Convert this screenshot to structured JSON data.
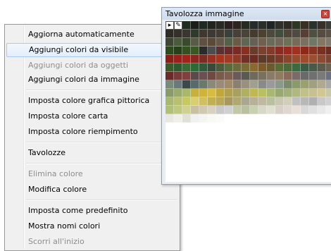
{
  "context_menu": {
    "items": [
      {
        "label": "Aggiorna automaticamente",
        "disabled": false
      },
      {
        "label": "Aggiungi colori da visibile",
        "disabled": false,
        "highlighted": true
      },
      {
        "label": "Aggiungi colori da oggetti",
        "disabled": true
      },
      {
        "label": "Aggiungi colori da immagine",
        "disabled": false
      },
      {
        "label": "Imposta colore grafica pittorica",
        "disabled": false
      },
      {
        "label": "Imposta colore carta",
        "disabled": false
      },
      {
        "label": "Imposta colore riempimento",
        "disabled": false
      },
      {
        "label": "Tavolozze",
        "disabled": false
      },
      {
        "label": "Elimina colore",
        "disabled": true
      },
      {
        "label": "Modifica colore",
        "disabled": false
      },
      {
        "label": "Imposta come predefinito",
        "disabled": false
      },
      {
        "label": "Mostra nomi colori",
        "disabled": false
      },
      {
        "label": "Scorri all'inizio",
        "disabled": true
      }
    ]
  },
  "palette_window": {
    "title": "Tavolozza immagine",
    "close_glyph": "×",
    "tool_icons": [
      "dropdown-arrow-icon",
      "eyedropper-icon"
    ],
    "tool_glyphs": [
      "▸",
      "✎"
    ],
    "swatch_rows": [
      [
        "#1f1f1f",
        "#1f1f1f",
        "#1f2b1f",
        "#1b1f1b",
        "#1e2a22",
        "#24241f",
        "#2a2a24",
        "#2b1f1f",
        "#2b241f",
        "#262a20",
        "#242b2a",
        "#2a2f2a",
        "#1f2424",
        "#30302a",
        "#302a24",
        "#2f3724",
        "#383024",
        "#2a3230",
        "#37302b",
        "#3a3d38"
      ],
      [
        "#2e2a26",
        "#35302a",
        "#3a3530",
        "#2f3a2c",
        "#40382e",
        "#3d3a35",
        "#443c32",
        "#3a403a",
        "#473f38",
        "#4a4438",
        "#453c2f",
        "#4b4232",
        "#4c4a3d",
        "#424d3c",
        "#504539",
        "#4f4a42",
        "#563f35",
        "#4e5040",
        "#574c42",
        "#5a5246"
      ],
      [
        "#3e4532",
        "#4a5a3a",
        "#3a4a2c",
        "#5a5a48",
        "#605040",
        "#5c4a38",
        "#63584a",
        "#556048",
        "#6a5a46",
        "#5e6654",
        "#665f55",
        "#706050",
        "#6a6a5a",
        "#73675a",
        "#6e7058",
        "#786a5a",
        "#7a7060",
        "#6f7866",
        "#847660",
        "#807a6c"
      ],
      [
        "#2d4a1e",
        "#284018",
        "#335220",
        "#3a5826",
        "#2a2a2a",
        "#4d4d4d",
        "#5a3030",
        "#6a2a2a",
        "#7a2a22",
        "#883020",
        "#6a3a2a",
        "#7a4030",
        "#843a2a",
        "#8a2a20",
        "#9a2a20",
        "#a03020",
        "#902818",
        "#883422",
        "#7a3020",
        "#6a2c20"
      ],
      [
        "#8a1f1a",
        "#9a2019",
        "#a2231c",
        "#8c2420",
        "#7d2a22",
        "#9a2f20",
        "#a8341e",
        "#a03a24",
        "#8e3a26",
        "#703028",
        "#6a2c22",
        "#5a3a2a",
        "#6a3a28",
        "#7a3a2a",
        "#8a442a",
        "#964a2e",
        "#a04a2c",
        "#9a5030",
        "#8a4a34",
        "#7a4430"
      ],
      [
        "#3a5a2a",
        "#2f5a2e",
        "#3a6a34",
        "#2c6a36",
        "#305a3a",
        "#3a4a3a",
        "#4a5a3a",
        "#5a6a3a",
        "#6a6a3a",
        "#7a6a34",
        "#8a6a30",
        "#7a5a2a",
        "#6a5a30",
        "#5a6a34",
        "#4a6a3a",
        "#3a6a40",
        "#3a5a44",
        "#4a5a4a",
        "#5a5a4a",
        "#6a6050"
      ],
      [
        "#6a2a2a",
        "#7a3a3a",
        "#804040",
        "#5a4a4a",
        "#6a5050",
        "#704a40",
        "#7a5a4a",
        "#806050",
        "#6a5a5a",
        "#5a5a50",
        "#706a5a",
        "#7a7060",
        "#8a7a68",
        "#907a60",
        "#8a6a5a",
        "#7a6a6a",
        "#6a6a6a",
        "#707070",
        "#7a7a7a",
        "#6a7080"
      ],
      [
        "#7a8a7a",
        "#6a7a7a",
        "#3a4a4a",
        "#5a6a6a",
        "#6a7a6a",
        "#8a8a7a",
        "#9a8a7a",
        "#a08a6a",
        "#8a8070",
        "#9a9080",
        "#a0a090",
        "#8a8a8a",
        "#9a9a9a",
        "#8a9a8a",
        "#7a8a6a",
        "#8a9a6a",
        "#9aa070",
        "#a0a080",
        "#b0a890",
        "#a8a8a8"
      ],
      [
        "#8a9a6a",
        "#9aaa6a",
        "#aab86a",
        "#c8b040",
        "#d0b43a",
        "#d8bc40",
        "#c0a838",
        "#b0a050",
        "#a8a060",
        "#b0b060",
        "#c0b850",
        "#b8c060",
        "#a8b870",
        "#98a870",
        "#a0b078",
        "#b0b880",
        "#c0c088",
        "#c8c090",
        "#d0c890",
        "#c8c8a8"
      ],
      [
        "#a8b870",
        "#b8c070",
        "#c8c860",
        "#d8d070",
        "#d0c060",
        "#c0b050",
        "#b8a858",
        "#a89860",
        "#b0a870",
        "#a8a890",
        "#b8b098",
        "#c0b8a0",
        "#b8c0a0",
        "#c8c8b0",
        "#d0d0b8",
        "#c0c0c0",
        "#b8b8b8",
        "#b0b0b0",
        "#c8c8c8",
        "#d0d0d0"
      ],
      [
        "#b0c078",
        "#c0c880",
        "#d0d090",
        "#c8c0a0",
        "#d0c8b0",
        "#d8d0c0",
        "#c8c8c8",
        "#d0d0d0",
        "#c0c8a8",
        "#b8c0a0",
        "#c8d0b0",
        "#d8d8c8",
        "#e0e0d0",
        "#d8d0c8",
        "#e0d8d0",
        "#e8e0d8",
        "#d8d8d8",
        "#e0e0e0",
        "#e8e8e8",
        "#f0f0f0"
      ],
      [
        "#e8e8e0",
        "#f0f0e8",
        "#e0e0d8",
        "#f0f0f0",
        "#f4f4f0",
        "#f8f8f4",
        "#fafafa",
        "#ffffff",
        "#ffffff",
        "#ffffff",
        "#ffffff",
        "#ffffff",
        "#ffffff",
        "#ffffff",
        "#ffffff",
        "#ffffff",
        "#ffffff",
        "#ffffff",
        "#ffffff",
        "#ffffff"
      ]
    ]
  }
}
